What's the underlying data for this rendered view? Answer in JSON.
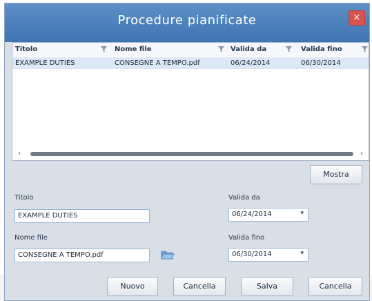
{
  "window": {
    "title": "Procedure pianificate",
    "close_glyph": "×"
  },
  "grid": {
    "columns": [
      "Titolo",
      "Nome file",
      "Valida da",
      "Valida fino"
    ],
    "rows": [
      {
        "titolo": "EXAMPLE DUTIES",
        "nome_file": "CONSEGNE A TEMPO.pdf",
        "valida_da": "06/24/2014",
        "valida_fino": "06/30/2014"
      }
    ],
    "scroll_left": "‹",
    "scroll_right": "›"
  },
  "buttons": {
    "mostra": "Mostra",
    "nuovo": "Nuovo",
    "cancella1": "Cancella",
    "salva": "Salva",
    "cancella2": "Cancella"
  },
  "form": {
    "titolo_label": "Titolo",
    "titolo_value": "EXAMPLE DUTIES",
    "nome_file_label": "Nome file",
    "nome_file_value": "CONSEGNE A TEMPO.pdf",
    "valida_da_label": "Valida da",
    "valida_da_value": "06/24/2014",
    "valida_fino_label": "Valida fino",
    "valida_fino_value": "06/30/2014",
    "dropdown_arrow": "▾"
  },
  "icons": {
    "filter": "filter-icon",
    "folder": "folder-open-icon"
  },
  "colors": {
    "titlebar": "#4a80bd",
    "close": "#d9534f",
    "selected_row": "#dbe8f6"
  }
}
